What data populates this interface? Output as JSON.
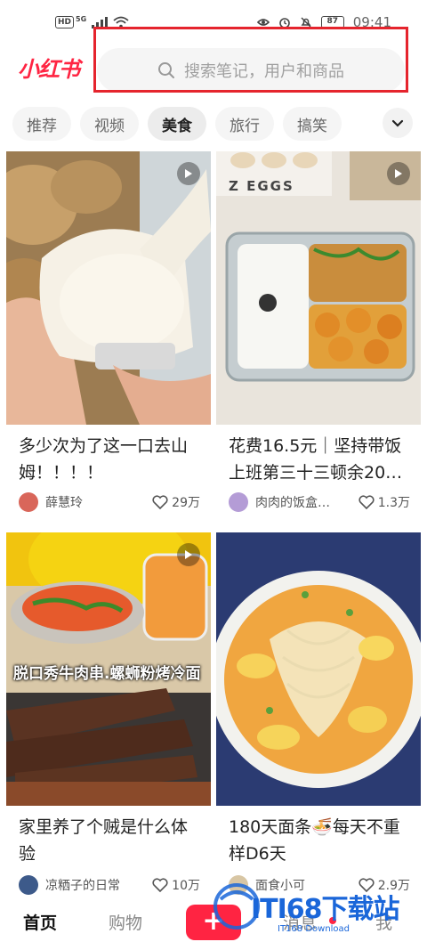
{
  "status_bar": {
    "network_badge": "HD",
    "network_type": "5G",
    "battery": "87",
    "time": "09:41"
  },
  "header": {
    "logo": "小红书",
    "search_placeholder": "搜索笔记，用户和商品"
  },
  "tabs": [
    {
      "label": "推荐",
      "active": false
    },
    {
      "label": "视频",
      "active": false
    },
    {
      "label": "美食",
      "active": true
    },
    {
      "label": "旅行",
      "active": false
    },
    {
      "label": "搞笑",
      "active": false
    }
  ],
  "feed": [
    {
      "title": "多少次为了这一口去山姆！！！！",
      "author": "薛慧玲",
      "likes": "29万",
      "is_video": true
    },
    {
      "title": "花费16.5元｜坚持带饭上班第三十三顿余20…",
      "author": "肉肉的饭盒…",
      "likes": "1.3万",
      "is_video": true,
      "photo_text": "Z EGGS"
    },
    {
      "title": "家里养了个贼是什么体验",
      "author": "凉粞子的日常",
      "likes": "10万",
      "is_video": true,
      "overlay_text": "脱口秀牛肉串.螺蛳粉烤冷面"
    },
    {
      "title": "180天面条🍜每天不重样D6天",
      "author": "面食小可",
      "likes": "2.9万",
      "is_video": false
    }
  ],
  "bottom_nav": {
    "home": "首页",
    "shop": "购物",
    "add": "+",
    "messages": "消息",
    "me": "我"
  },
  "watermark": {
    "text": "ITI68下载站",
    "sub": "IT168 Download"
  },
  "colors": {
    "brand": "#ff2442",
    "highlight_box": "#e5242d",
    "watermark": "#1a66d9"
  }
}
